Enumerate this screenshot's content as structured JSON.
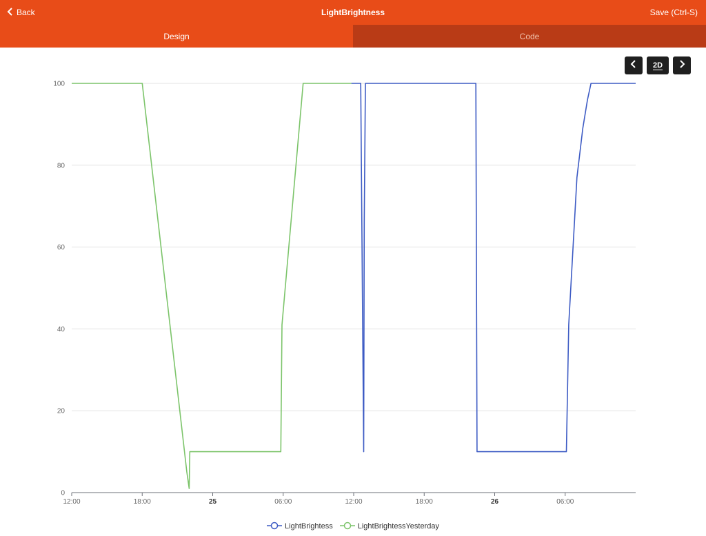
{
  "header": {
    "back_label": "Back",
    "title": "LightBrightness",
    "save_label": "Save (Ctrl-S)"
  },
  "tabs": [
    {
      "label": "Design",
      "active": true
    },
    {
      "label": "Code",
      "active": false
    }
  ],
  "view_controls": {
    "prev_icon": "chevron-left-icon",
    "mode_label": "2D",
    "next_icon": "chevron-right-icon"
  },
  "colors": {
    "accent": "#e84c18",
    "accent_dark": "#b93b16",
    "series_1": "#3d5bc4",
    "series_2": "#7cc46a"
  },
  "chart_data": {
    "type": "line",
    "title": "",
    "xlabel": "",
    "ylabel": "",
    "ylim": [
      0,
      100
    ],
    "yticks": [
      "0",
      "20",
      "40",
      "60",
      "80",
      "100"
    ],
    "xticks": [
      {
        "label": "12:00",
        "bold": false
      },
      {
        "label": "18:00",
        "bold": false
      },
      {
        "label": "25",
        "bold": true
      },
      {
        "label": "06:00",
        "bold": false
      },
      {
        "label": "12:00",
        "bold": false
      },
      {
        "label": "18:00",
        "bold": false
      },
      {
        "label": "26",
        "bold": true
      },
      {
        "label": "06:00",
        "bold": false
      }
    ],
    "x_unit": "hours after the first 12:00 tick",
    "xlim": [
      0,
      48
    ],
    "grid": true,
    "legend_position": "bottom-center",
    "series": [
      {
        "name": "LightBrightess",
        "color": "#3d5bc4",
        "points": [
          [
            23.8,
            100
          ],
          [
            24.6,
            100
          ],
          [
            24.85,
            10
          ],
          [
            24.9,
            66
          ],
          [
            25.0,
            100
          ],
          [
            34.4,
            100
          ],
          [
            34.5,
            10
          ],
          [
            42.1,
            10
          ],
          [
            42.3,
            41
          ],
          [
            43.0,
            77
          ],
          [
            43.5,
            89
          ],
          [
            43.9,
            96
          ],
          [
            44.2,
            100
          ],
          [
            48,
            100
          ]
        ]
      },
      {
        "name": "LightBrightessYesterday",
        "color": "#7cc46a",
        "points": [
          [
            0,
            100
          ],
          [
            6.0,
            100
          ],
          [
            9.8,
            5
          ],
          [
            10.0,
            1
          ],
          [
            10.05,
            10
          ],
          [
            17.8,
            10
          ],
          [
            17.9,
            41
          ],
          [
            19.7,
            100
          ],
          [
            23.8,
            100
          ]
        ]
      }
    ]
  }
}
